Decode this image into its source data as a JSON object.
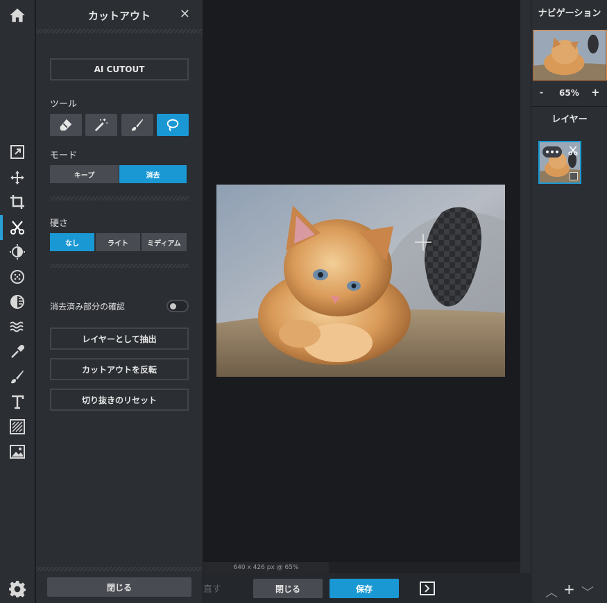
{
  "cutout_panel": {
    "title": "カットアウト",
    "close_glyph": "✕",
    "ai_cutout_label": "AI CUTOUT",
    "tool_label": "ツール",
    "tools": [
      "eraser-icon",
      "magic-wand-icon",
      "brush-icon",
      "lasso-icon"
    ],
    "selected_tool": "lasso-icon",
    "mode_label": "モード",
    "mode_keep": "キープ",
    "mode_erase": "消去",
    "selected_mode": "消去",
    "hardness_label": "硬さ",
    "hardness_none": "なし",
    "hardness_light": "ライト",
    "hardness_medium": "ミディアム",
    "selected_hardness": "なし",
    "show_erased_label": "消去済み部分の確認",
    "show_erased_on": false,
    "extract_layer": "レイヤーとして抽出",
    "invert_cutout": "カットアウトを反転",
    "reset_cutout": "切り抜きのリセット",
    "close_button": "閉じる"
  },
  "canvas": {
    "status": "640 x 426 px @ 65%"
  },
  "bottom_bar": {
    "redo_ghost": "直す",
    "close_label": "閉じる",
    "save_label": "保存"
  },
  "right_panel": {
    "navigation_title": "ナビゲーション",
    "zoom_minus": "-",
    "zoom_value": "65%",
    "zoom_plus": "+",
    "layers_title": "レイヤー",
    "layer_menu": "•••"
  },
  "colors": {
    "accent": "#1a98d4",
    "nav_frame": "#e08a45"
  }
}
